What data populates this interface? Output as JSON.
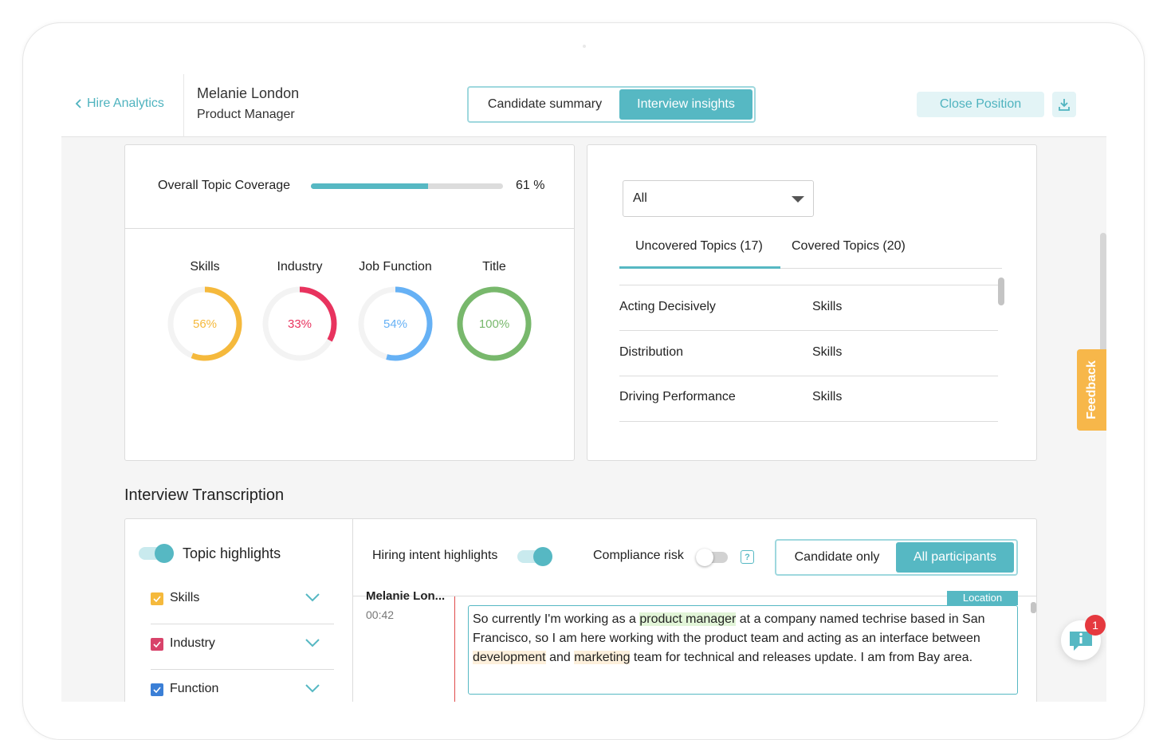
{
  "header": {
    "back_label": "Hire Analytics",
    "candidate_name": "Melanie London",
    "candidate_role": "Product Manager",
    "view_tabs": [
      "Candidate summary",
      "Interview insights"
    ],
    "active_view_tab": "Interview insights",
    "close_position_label": "Close Position"
  },
  "coverage": {
    "label": "Overall Topic Coverage",
    "value_text": "61 %",
    "fraction": 0.61
  },
  "donuts": [
    {
      "label": "Skills",
      "value_text": "56%",
      "fraction": 0.56,
      "color": "#f5b93c"
    },
    {
      "label": "Industry",
      "value_text": "33%",
      "fraction": 0.33,
      "color": "#e8335e"
    },
    {
      "label": "Job Function",
      "value_text": "54%",
      "fraction": 0.54,
      "color": "#66b1f5"
    },
    {
      "label": "Title",
      "value_text": "100%",
      "fraction": 1.0,
      "color": "#78b86c"
    }
  ],
  "topics": {
    "filter_value": "All",
    "tabs": [
      "Uncovered Topics (17)",
      "Covered Topics (20)"
    ],
    "active_tab": "Uncovered Topics (17)",
    "rows": [
      {
        "topic": "Acting Decisively",
        "category": "Skills"
      },
      {
        "topic": "Distribution",
        "category": "Skills"
      },
      {
        "topic": "Driving Performance",
        "category": "Skills"
      }
    ]
  },
  "feedback_label": "Feedback",
  "transcription": {
    "title": "Interview Transcription",
    "topic_highlights_label": "Topic highlights",
    "categories": [
      {
        "label": "Skills",
        "color": "#f5b93c"
      },
      {
        "label": "Industry",
        "color": "#d8436a"
      },
      {
        "label": "Function",
        "color": "#3b7fd6"
      }
    ],
    "hiring_intent_label": "Hiring intent highlights",
    "compliance_risk_label": "Compliance risk",
    "help_icon_text": "?",
    "participants_tabs": [
      "Candidate only",
      "All participants"
    ],
    "active_participants_tab": "All participants",
    "speaker": "Melanie Lon...",
    "timestamp": "00:42",
    "location_tag": "Location",
    "segments": [
      {
        "text": "So currently I'm working as a ",
        "hl": ""
      },
      {
        "text": "product manager",
        "hl": "green"
      },
      {
        "text": " at a company named techrise based in San Francisco, so I am here working with the product team and acting as an interface between ",
        "hl": ""
      },
      {
        "text": "development",
        "hl": "orange"
      },
      {
        "text": " and ",
        "hl": ""
      },
      {
        "text": "marketing",
        "hl": "orange"
      },
      {
        "text": " team for technical and releases update. I am from Bay area.",
        "hl": ""
      }
    ]
  },
  "chat": {
    "badge_count": "1"
  },
  "colors": {
    "accent": "#56b8c3",
    "feedback": "#f7b74a",
    "badge": "#e5393f"
  }
}
